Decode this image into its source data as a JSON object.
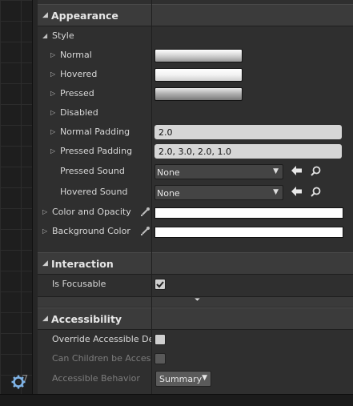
{
  "canvas": {
    "corner_number": "7"
  },
  "appearance": {
    "title": "Appearance",
    "style_label": "Style",
    "brush_rows": [
      {
        "label": "Normal",
        "brush_icon": "brush-swatch"
      },
      {
        "label": "Hovered",
        "brush_icon": "brush-swatch"
      },
      {
        "label": "Pressed",
        "brush_icon": "brush-swatch"
      },
      {
        "label": "Disabled",
        "brush_icon": "none"
      }
    ],
    "normal_padding": {
      "label": "Normal Padding",
      "value": "2.0"
    },
    "pressed_padding": {
      "label": "Pressed Padding",
      "value": "2.0, 3.0, 2.0, 1.0"
    },
    "pressed_sound": {
      "label": "Pressed Sound",
      "value": "None"
    },
    "hovered_sound": {
      "label": "Hovered Sound",
      "value": "None"
    },
    "color_and_opacity": {
      "label": "Color and Opacity",
      "color": "#ffffff"
    },
    "background_color": {
      "label": "Background Color",
      "color": "#ffffff"
    }
  },
  "interaction": {
    "title": "Interaction",
    "is_focusable": {
      "label": "Is Focusable",
      "checked": true
    }
  },
  "accessibility": {
    "title": "Accessibility",
    "override": {
      "label": "Override Accessible Defa",
      "checked": false
    },
    "children": {
      "label": "Can Children be Accessit",
      "checked": false,
      "enabled": false
    },
    "behavior": {
      "label": "Accessible Behavior",
      "value": "Summary"
    }
  },
  "colors": {
    "panel_bg": "#2f2f2f",
    "category_bg": "#3b3b3b",
    "text": "#d8d8d8",
    "text_disabled": "#7d7d7d",
    "gear_blue": "#7fb3e6"
  }
}
